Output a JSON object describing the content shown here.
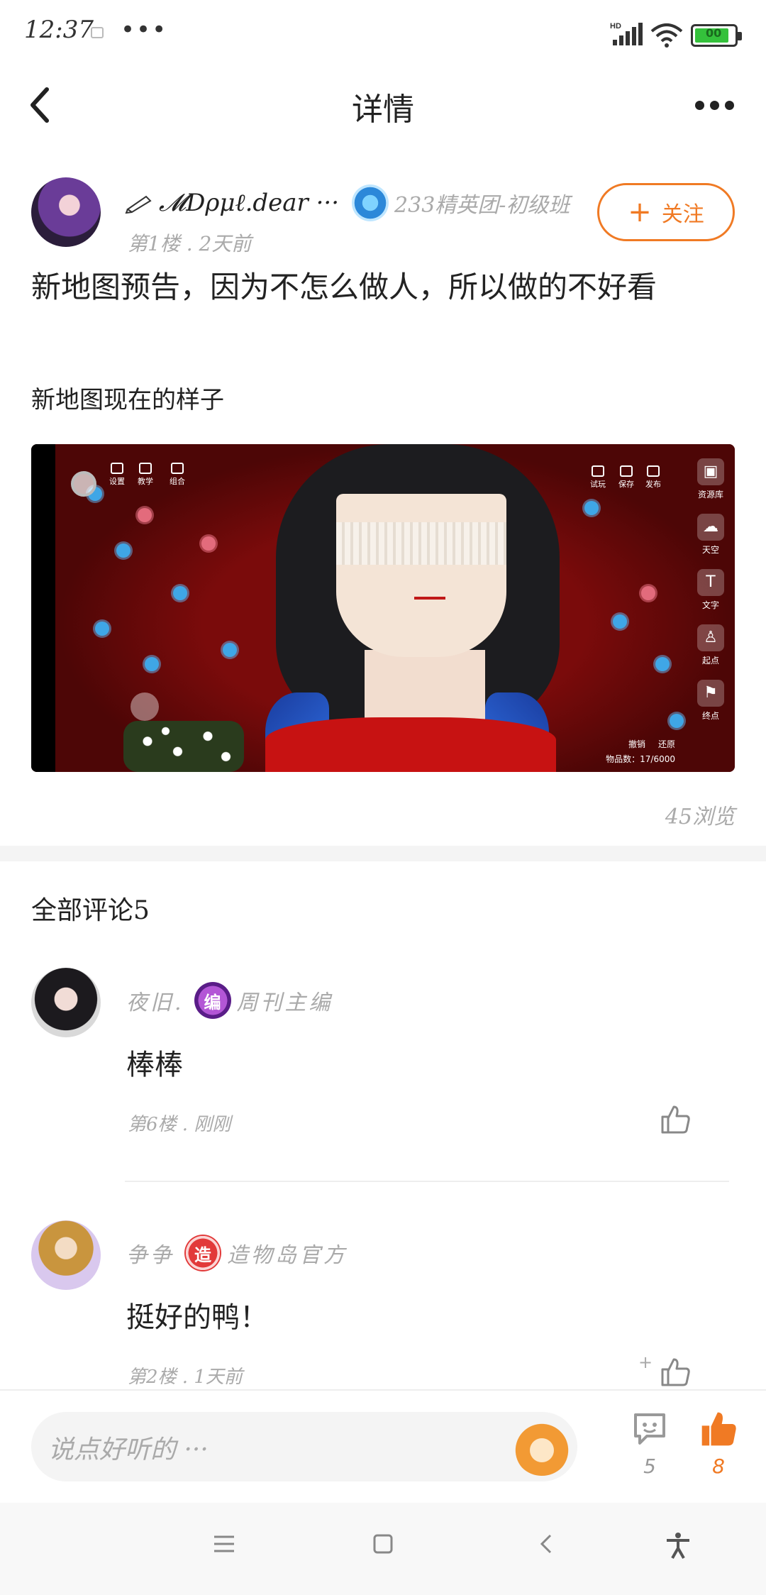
{
  "status_bar": {
    "time": "12:37",
    "dots": "•••",
    "network": "HD",
    "battery": "00"
  },
  "header": {
    "title": "详情"
  },
  "post": {
    "author": {
      "name": "𝓜Dρμℓ.dear ···",
      "title": "233精英团-初级班",
      "meta": "第1楼 . 2天前"
    },
    "follow_label": "关注",
    "follow_plus": "+",
    "title": "新地图预告，因为不怎么做人，所以做的不好看",
    "subtitle": "新地图现在的样子",
    "views": "45浏览",
    "image": {
      "toolbar_left": [
        "设置",
        "教学",
        "组合"
      ],
      "toolbar_right": [
        "试玩",
        "保存",
        "发布"
      ],
      "side_items": [
        {
          "label": "资源库",
          "glyph": "▣"
        },
        {
          "label": "天空",
          "glyph": "☁"
        },
        {
          "label": "文字",
          "glyph": "T"
        },
        {
          "label": "起点",
          "glyph": "♙"
        },
        {
          "label": "终点",
          "glyph": "⚑"
        }
      ],
      "undo_label": "撤销",
      "redo_label": "还原",
      "object_count": "物品数：17/6000"
    }
  },
  "comments": {
    "heading": "全部评论5",
    "items": [
      {
        "author": "夜旧.",
        "badge": "编",
        "role": "周刊主编",
        "text": "棒棒",
        "meta": "第6楼 . 刚刚",
        "likes": ""
      },
      {
        "author": "争争",
        "badge": "造",
        "role": "造物岛官方",
        "text": "挺好的鸭！",
        "meta": "第2楼 . 1天前",
        "likes": "+"
      }
    ]
  },
  "bottom_bar": {
    "placeholder": "说点好听的 ···",
    "comment_count": "5",
    "like_count": "8"
  },
  "colors": {
    "accent": "#f07a24",
    "muted": "#aaaaaa",
    "text": "#222222"
  }
}
